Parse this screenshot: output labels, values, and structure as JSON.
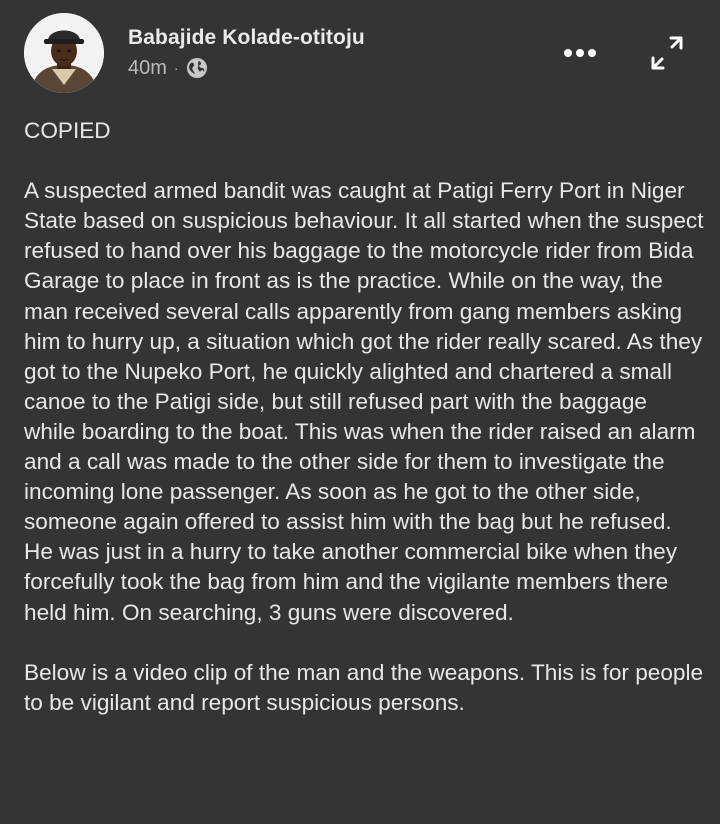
{
  "post": {
    "author_name": "Babajide Kolade-otitoju",
    "timestamp": "40m",
    "separator": "·",
    "privacy_icon": "globe-icon",
    "menu_icon": "more-options-icon",
    "expand_icon": "expand-icon",
    "body": {
      "heading": "COPIED",
      "paragraph_1": "A suspected armed bandit was caught at Patigi Ferry Port in Niger State based on suspicious behaviour. It all started when the suspect refused to hand over his baggage to the motorcycle rider from Bida Garage to place in front as is the practice. While on the way, the man received several calls apparently from gang members asking him to hurry up, a situation which got the rider really scared. As they got to the Nupeko Port, he quickly alighted and chartered a small canoe to the Patigi side, but still refused part with the baggage while boarding to the boat. This was when the rider raised an alarm and a call was made to the other side for them to investigate the incoming lone passenger. As soon as he got to the other side, someone again offered to assist him with the bag but he refused. He was just in a hurry to take another commercial bike when they forcefully took the bag from him and the vigilante members there held him. On searching, 3 guns were discovered.",
      "paragraph_2": "Below is a video clip of the man and the weapons. This is for people to be vigilant and report suspicious persons."
    }
  },
  "colors": {
    "background": "#333436",
    "text_primary": "#e8e8e8",
    "text_secondary": "#b9bbbe",
    "icon": "#ffffff"
  }
}
